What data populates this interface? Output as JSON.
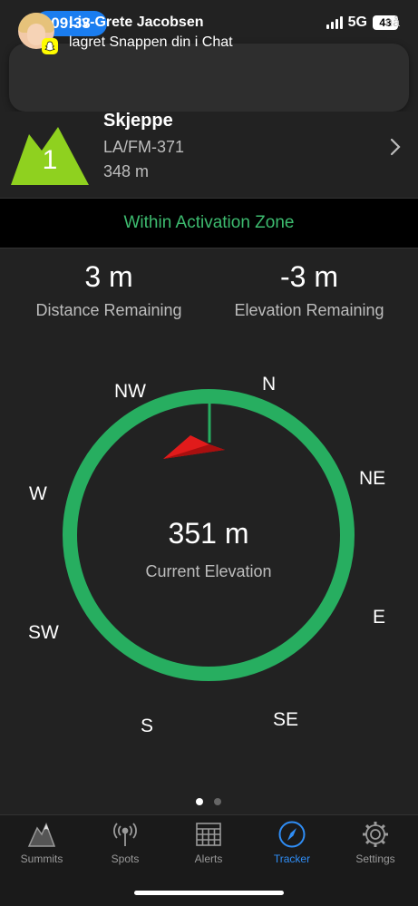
{
  "status_bar": {
    "time": "09:33",
    "network": "5G",
    "battery": "43"
  },
  "notification": {
    "sender": "Liv-Grete Jacobsen",
    "message": "lagret Snappen din i Chat",
    "time": "nå"
  },
  "summit": {
    "rank": "1",
    "name": "Skjeppe",
    "code": "LA/FM-371",
    "elevation": "348 m"
  },
  "activation_status": "Within Activation Zone",
  "stats": {
    "distance_value": "3 m",
    "distance_label": "Distance Remaining",
    "elevation_value": "-3 m",
    "elevation_label": "Elevation Remaining"
  },
  "compass": {
    "directions": {
      "n": "N",
      "ne": "NE",
      "e": "E",
      "se": "SE",
      "s": "S",
      "sw": "SW",
      "w": "W",
      "nw": "NW"
    },
    "current_elevation_value": "351 m",
    "current_elevation_label": "Current Elevation",
    "ring_color": "#27ae60",
    "pointer_color": "#e11b1b"
  },
  "pager": {
    "pages": 2,
    "active": 1
  },
  "tabs": [
    {
      "label": "Summits",
      "icon": "mountain-icon",
      "active": false
    },
    {
      "label": "Spots",
      "icon": "antenna-icon",
      "active": false
    },
    {
      "label": "Alerts",
      "icon": "calendar-grid-icon",
      "active": false
    },
    {
      "label": "Tracker",
      "icon": "compass-icon",
      "active": true
    },
    {
      "label": "Settings",
      "icon": "gear-icon",
      "active": false
    }
  ],
  "colors": {
    "accent": "#2f8df5",
    "zone_green": "#3dbb6f",
    "summit_green": "#8fd11f"
  }
}
